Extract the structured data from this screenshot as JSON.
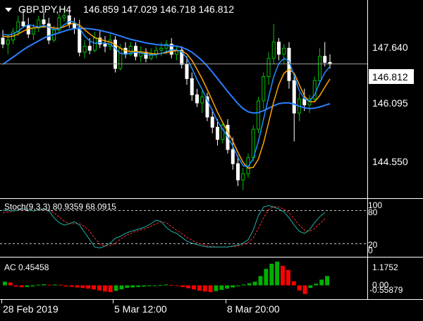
{
  "main": {
    "symbol_label": "GBPJPY,H4",
    "ohlc": "146.859 147.029 146.718 146.812",
    "price_ticks": [
      "147.640",
      "146.095",
      "144.550"
    ],
    "current_price": "146.812",
    "price_range": [
      143.55,
      148.25
    ],
    "colors": {
      "bull": "#00c000",
      "bear": "#ffffff",
      "ma_fast": "#1e90ff",
      "ma_slow": "#ffa500",
      "ma_long": "#2a7fff"
    }
  },
  "stoch": {
    "label": "Stoch(9,3,3) 80.9359 68.0915",
    "ticks": [
      "100",
      "80",
      "20",
      "0"
    ],
    "levels": [
      80,
      20
    ],
    "colors": {
      "main": "#20b2aa",
      "signal": "#ff3030"
    }
  },
  "ac": {
    "label": "AC 0.45458",
    "ticks": [
      "1.1752",
      "0.00",
      "-0.55879"
    ],
    "range": [
      -0.6,
      1.25
    ],
    "colors": {
      "up": "#00b000",
      "down": "#ff0000"
    }
  },
  "time_axis": {
    "labels": [
      "28 Feb 2019",
      "5 Mar 12:00",
      "8 Mar 20:00"
    ]
  },
  "chart_data": [
    {
      "type": "candlestick",
      "title": "GBPJPY,H4",
      "ylim": [
        143.55,
        148.25
      ],
      "series": [
        {
          "name": "ohlc",
          "values": [
            [
              147.45,
              147.65,
              147.2,
              147.3
            ],
            [
              147.3,
              147.55,
              147.05,
              147.4
            ],
            [
              147.4,
              147.7,
              147.3,
              147.6
            ],
            [
              147.6,
              148.0,
              147.5,
              147.85
            ],
            [
              147.85,
              148.15,
              147.7,
              147.75
            ],
            [
              147.75,
              147.95,
              147.45,
              147.55
            ],
            [
              147.55,
              147.8,
              147.4,
              147.7
            ],
            [
              147.7,
              148.0,
              147.6,
              147.9
            ],
            [
              147.9,
              148.1,
              147.7,
              147.8
            ],
            [
              147.8,
              147.95,
              147.3,
              147.4
            ],
            [
              147.4,
              147.75,
              147.35,
              147.65
            ],
            [
              147.65,
              148.05,
              147.6,
              147.95
            ],
            [
              147.95,
              148.2,
              147.85,
              148.0
            ],
            [
              148.0,
              148.15,
              147.7,
              147.8
            ],
            [
              147.8,
              147.95,
              147.55,
              147.7
            ],
            [
              147.7,
              147.9,
              147.0,
              147.1
            ],
            [
              147.1,
              147.4,
              146.95,
              147.25
            ],
            [
              147.25,
              147.45,
              147.05,
              147.15
            ],
            [
              147.15,
              147.6,
              147.1,
              147.45
            ],
            [
              147.45,
              147.65,
              147.2,
              147.3
            ],
            [
              147.3,
              147.5,
              147.1,
              147.25
            ],
            [
              147.25,
              147.55,
              147.15,
              147.4
            ],
            [
              147.4,
              147.5,
              146.6,
              146.7
            ],
            [
              146.7,
              147.3,
              146.65,
              147.2
            ],
            [
              147.2,
              147.35,
              146.95,
              147.05
            ],
            [
              147.05,
              147.35,
              147.0,
              147.25
            ],
            [
              147.25,
              147.35,
              146.9,
              147.0
            ],
            [
              147.0,
              147.25,
              146.85,
              147.1
            ],
            [
              147.1,
              147.2,
              146.85,
              146.95
            ],
            [
              146.95,
              147.2,
              146.9,
              147.05
            ],
            [
              147.05,
              147.25,
              146.95,
              147.15
            ],
            [
              147.15,
              147.35,
              147.0,
              147.2
            ],
            [
              147.2,
              147.4,
              147.05,
              147.3
            ],
            [
              147.3,
              147.45,
              146.95,
              147.05
            ],
            [
              147.05,
              147.25,
              146.9,
              147.15
            ],
            [
              147.15,
              147.25,
              146.7,
              146.8
            ],
            [
              146.8,
              147.0,
              146.3,
              146.45
            ],
            [
              146.45,
              146.6,
              145.9,
              146.05
            ],
            [
              146.05,
              146.2,
              145.75,
              145.85
            ],
            [
              145.85,
              146.15,
              145.6,
              146.0
            ],
            [
              146.0,
              146.1,
              145.4,
              145.5
            ],
            [
              145.5,
              145.7,
              145.1,
              145.25
            ],
            [
              145.25,
              145.45,
              144.8,
              144.95
            ],
            [
              144.95,
              145.4,
              144.85,
              145.3
            ],
            [
              145.3,
              145.45,
              144.6,
              144.7
            ],
            [
              144.7,
              145.0,
              144.2,
              144.35
            ],
            [
              144.35,
              144.55,
              143.8,
              143.95
            ],
            [
              143.95,
              144.25,
              143.7,
              144.1
            ],
            [
              144.1,
              144.6,
              144.0,
              144.5
            ],
            [
              144.5,
              145.3,
              144.4,
              145.2
            ],
            [
              145.2,
              146.0,
              145.1,
              145.9
            ],
            [
              145.9,
              146.6,
              145.7,
              146.5
            ],
            [
              146.5,
              147.1,
              146.3,
              146.95
            ],
            [
              146.95,
              147.8,
              146.8,
              147.35
            ],
            [
              147.35,
              147.45,
              146.9,
              147.05
            ],
            [
              147.05,
              147.3,
              146.8,
              147.2
            ],
            [
              147.2,
              147.35,
              146.2,
              146.4
            ],
            [
              146.4,
              146.55,
              144.9,
              145.6
            ],
            [
              145.6,
              146.1,
              145.4,
              145.95
            ],
            [
              145.95,
              146.2,
              145.65,
              145.8
            ],
            [
              145.8,
              146.05,
              145.6,
              145.95
            ],
            [
              145.95,
              146.5,
              145.9,
              146.4
            ],
            [
              146.4,
              147.2,
              146.3,
              147.0
            ],
            [
              147.0,
              147.35,
              146.75,
              146.85
            ],
            [
              146.85,
              147.05,
              146.7,
              146.81
            ]
          ]
        },
        {
          "name": "ma_fast",
          "values": [
            147.55,
            147.52,
            147.55,
            147.62,
            147.72,
            147.78,
            147.75,
            147.72,
            147.76,
            147.72,
            147.65,
            147.68,
            147.78,
            147.86,
            147.85,
            147.7,
            147.5,
            147.38,
            147.32,
            147.34,
            147.32,
            147.3,
            147.2,
            147.07,
            147.05,
            147.08,
            147.1,
            147.08,
            147.05,
            147.03,
            147.04,
            147.07,
            147.12,
            147.16,
            147.16,
            147.11,
            146.96,
            146.7,
            146.42,
            146.18,
            145.92,
            145.66,
            145.4,
            145.2,
            145.01,
            144.78,
            144.51,
            144.3,
            144.28,
            144.48,
            144.9,
            145.45,
            145.99,
            146.5,
            146.82,
            146.95,
            146.88,
            146.52,
            146.15,
            145.95,
            145.9,
            146.05,
            146.35,
            146.6,
            146.75
          ]
        },
        {
          "name": "ma_slow",
          "values": [
            147.5,
            147.48,
            147.5,
            147.55,
            147.62,
            147.68,
            147.7,
            147.71,
            147.73,
            147.73,
            147.7,
            147.69,
            147.73,
            147.79,
            147.82,
            147.77,
            147.66,
            147.55,
            147.46,
            147.42,
            147.38,
            147.35,
            147.29,
            147.2,
            147.14,
            147.12,
            147.12,
            147.11,
            147.09,
            147.07,
            147.06,
            147.07,
            147.09,
            147.12,
            147.14,
            147.13,
            147.06,
            146.9,
            146.68,
            146.44,
            146.18,
            145.9,
            145.62,
            145.37,
            145.14,
            144.9,
            144.63,
            144.38,
            144.24,
            144.26,
            144.46,
            144.86,
            145.36,
            145.88,
            146.3,
            146.58,
            146.68,
            146.58,
            146.3,
            146.02,
            145.88,
            145.88,
            146.03,
            146.24,
            146.44
          ]
        },
        {
          "name": "ma_long",
          "values": [
            146.8,
            146.89,
            146.98,
            147.07,
            147.16,
            147.24,
            147.31,
            147.38,
            147.45,
            147.5,
            147.54,
            147.58,
            147.62,
            147.66,
            147.68,
            147.69,
            147.69,
            147.68,
            147.66,
            147.64,
            147.61,
            147.58,
            147.54,
            147.5,
            147.46,
            147.42,
            147.39,
            147.36,
            147.33,
            147.31,
            147.29,
            147.28,
            147.27,
            147.26,
            147.25,
            147.22,
            147.17,
            147.1,
            147.0,
            146.89,
            146.76,
            146.61,
            146.45,
            146.29,
            146.13,
            145.98,
            145.83,
            145.71,
            145.63,
            145.6,
            145.61,
            145.66,
            145.72,
            145.78,
            145.83,
            145.85,
            145.85,
            145.82,
            145.77,
            145.73,
            145.71,
            145.72,
            145.75,
            145.79,
            145.83
          ]
        }
      ]
    },
    {
      "type": "line",
      "title": "Stoch(9,3,3) 80.9359 68.0915",
      "ylim": [
        0,
        100
      ],
      "series": [
        {
          "name": "main",
          "values": [
            86,
            85,
            84,
            86,
            88,
            86,
            84,
            86,
            88,
            85,
            70,
            60,
            55,
            58,
            62,
            55,
            40,
            25,
            10,
            8,
            12,
            18,
            28,
            32,
            38,
            42,
            45,
            48,
            52,
            58,
            65,
            62,
            50,
            42,
            38,
            30,
            22,
            18,
            15,
            12,
            10,
            10,
            10,
            10,
            10,
            12,
            14,
            18,
            25,
            45,
            75,
            92,
            95,
            92,
            88,
            82,
            70,
            55,
            42,
            38,
            45,
            60,
            72,
            80.94
          ]
        },
        {
          "name": "signal",
          "values": [
            80,
            82,
            84,
            85,
            86,
            86,
            85,
            85,
            86,
            86,
            80,
            72,
            63,
            58,
            58,
            58,
            52,
            42,
            28,
            16,
            12,
            13,
            18,
            26,
            33,
            38,
            42,
            45,
            48,
            53,
            58,
            62,
            60,
            52,
            44,
            38,
            30,
            24,
            19,
            15,
            12,
            11,
            10,
            10,
            10,
            11,
            12,
            15,
            19,
            29,
            48,
            70,
            87,
            93,
            92,
            88,
            80,
            68,
            55,
            45,
            42,
            48,
            58,
            68.09
          ]
        }
      ]
    },
    {
      "type": "bar",
      "title": "AC 0.45458",
      "ylim": [
        -0.6,
        1.25
      ],
      "values": [
        0.18,
        0.14,
        -0.06,
        -0.09,
        -0.08,
        -0.05,
        0.03,
        0.05,
        0.03,
        0.04,
        0.03,
        -0.05,
        -0.07,
        -0.1,
        -0.12,
        -0.16,
        -0.2,
        -0.25,
        -0.3,
        -0.33,
        -0.27,
        -0.19,
        -0.12,
        -0.1,
        -0.08,
        -0.06,
        -0.04,
        -0.02,
        0.02,
        0.04,
        0.02,
        -0.03,
        -0.08,
        -0.14,
        -0.2,
        -0.26,
        -0.3,
        -0.33,
        -0.28,
        -0.22,
        -0.16,
        -0.1,
        -0.04,
        0.04,
        0.1,
        0.18,
        0.45,
        0.8,
        1.05,
        1.15,
        0.95,
        0.75,
        0.2,
        -0.25,
        -0.42,
        -0.12,
        0.08,
        0.28,
        0.45458
      ]
    }
  ]
}
